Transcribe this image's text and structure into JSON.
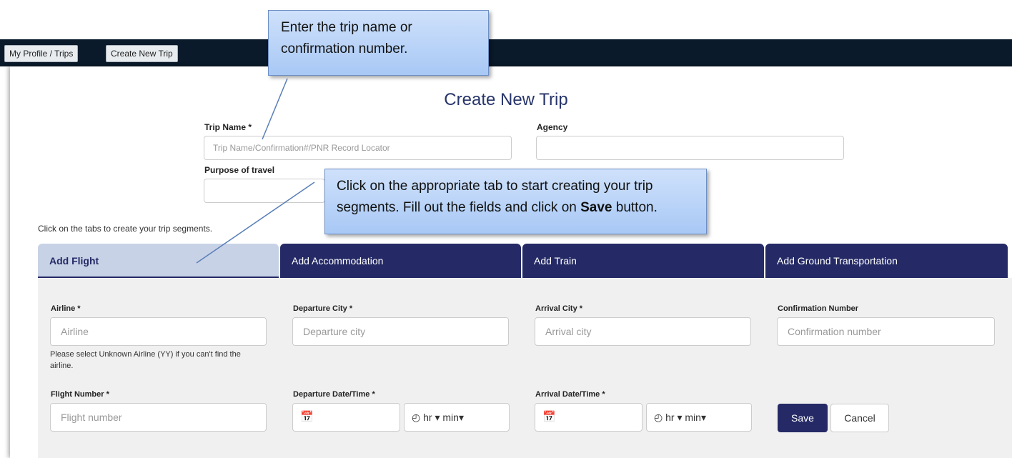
{
  "nav": {
    "profile_label": "My Profile / Trips",
    "create_label": "Create New Trip"
  },
  "page": {
    "title": "Create New Trip"
  },
  "trip_form": {
    "trip_name_label": "Trip Name *",
    "trip_name_placeholder": "Trip Name/Confirmation#/PNR Record Locator",
    "agency_label": "Agency",
    "agency_value": "",
    "purpose_label": "Purpose of travel",
    "purpose_value": ""
  },
  "tabs_hint": "Click on the tabs to create your trip segments.",
  "tabs": [
    {
      "label": "Add Flight",
      "active": true
    },
    {
      "label": "Add Accommodation",
      "active": false
    },
    {
      "label": "Add Train",
      "active": false
    },
    {
      "label": "Add Ground Transportation",
      "active": false
    }
  ],
  "flight_form": {
    "airline_label": "Airline *",
    "airline_placeholder": "Airline",
    "airline_hint": "Please select Unknown Airline (YY) if you can't find the airline.",
    "departure_city_label": "Departure City *",
    "departure_city_placeholder": "Departure city",
    "arrival_city_label": "Arrival City *",
    "arrival_city_placeholder": "Arrival city",
    "confirmation_label": "Confirmation Number",
    "confirmation_placeholder": "Confirmation number",
    "flight_number_label": "Flight Number *",
    "flight_number_placeholder": "Flight number",
    "departure_datetime_label": "Departure Date/Time *",
    "arrival_datetime_label": "Arrival Date/Time *",
    "hour_label": "hr",
    "minute_label": "min",
    "save_label": "Save",
    "cancel_label": "Cancel"
  },
  "callouts": {
    "top_line1": "Enter the trip name or",
    "top_line2": "confirmation number.",
    "middle_line1": "Click on the appropriate tab to start creating your trip",
    "middle_line2a": "segments. Fill out the fields and click on ",
    "middle_line2b": "Save",
    "middle_line2c": " button."
  },
  "colors": {
    "navbar": "#0a1a2a",
    "tab": "#252a66",
    "tab_active": "#c8d2e6",
    "callout": "#b9d3f8"
  }
}
